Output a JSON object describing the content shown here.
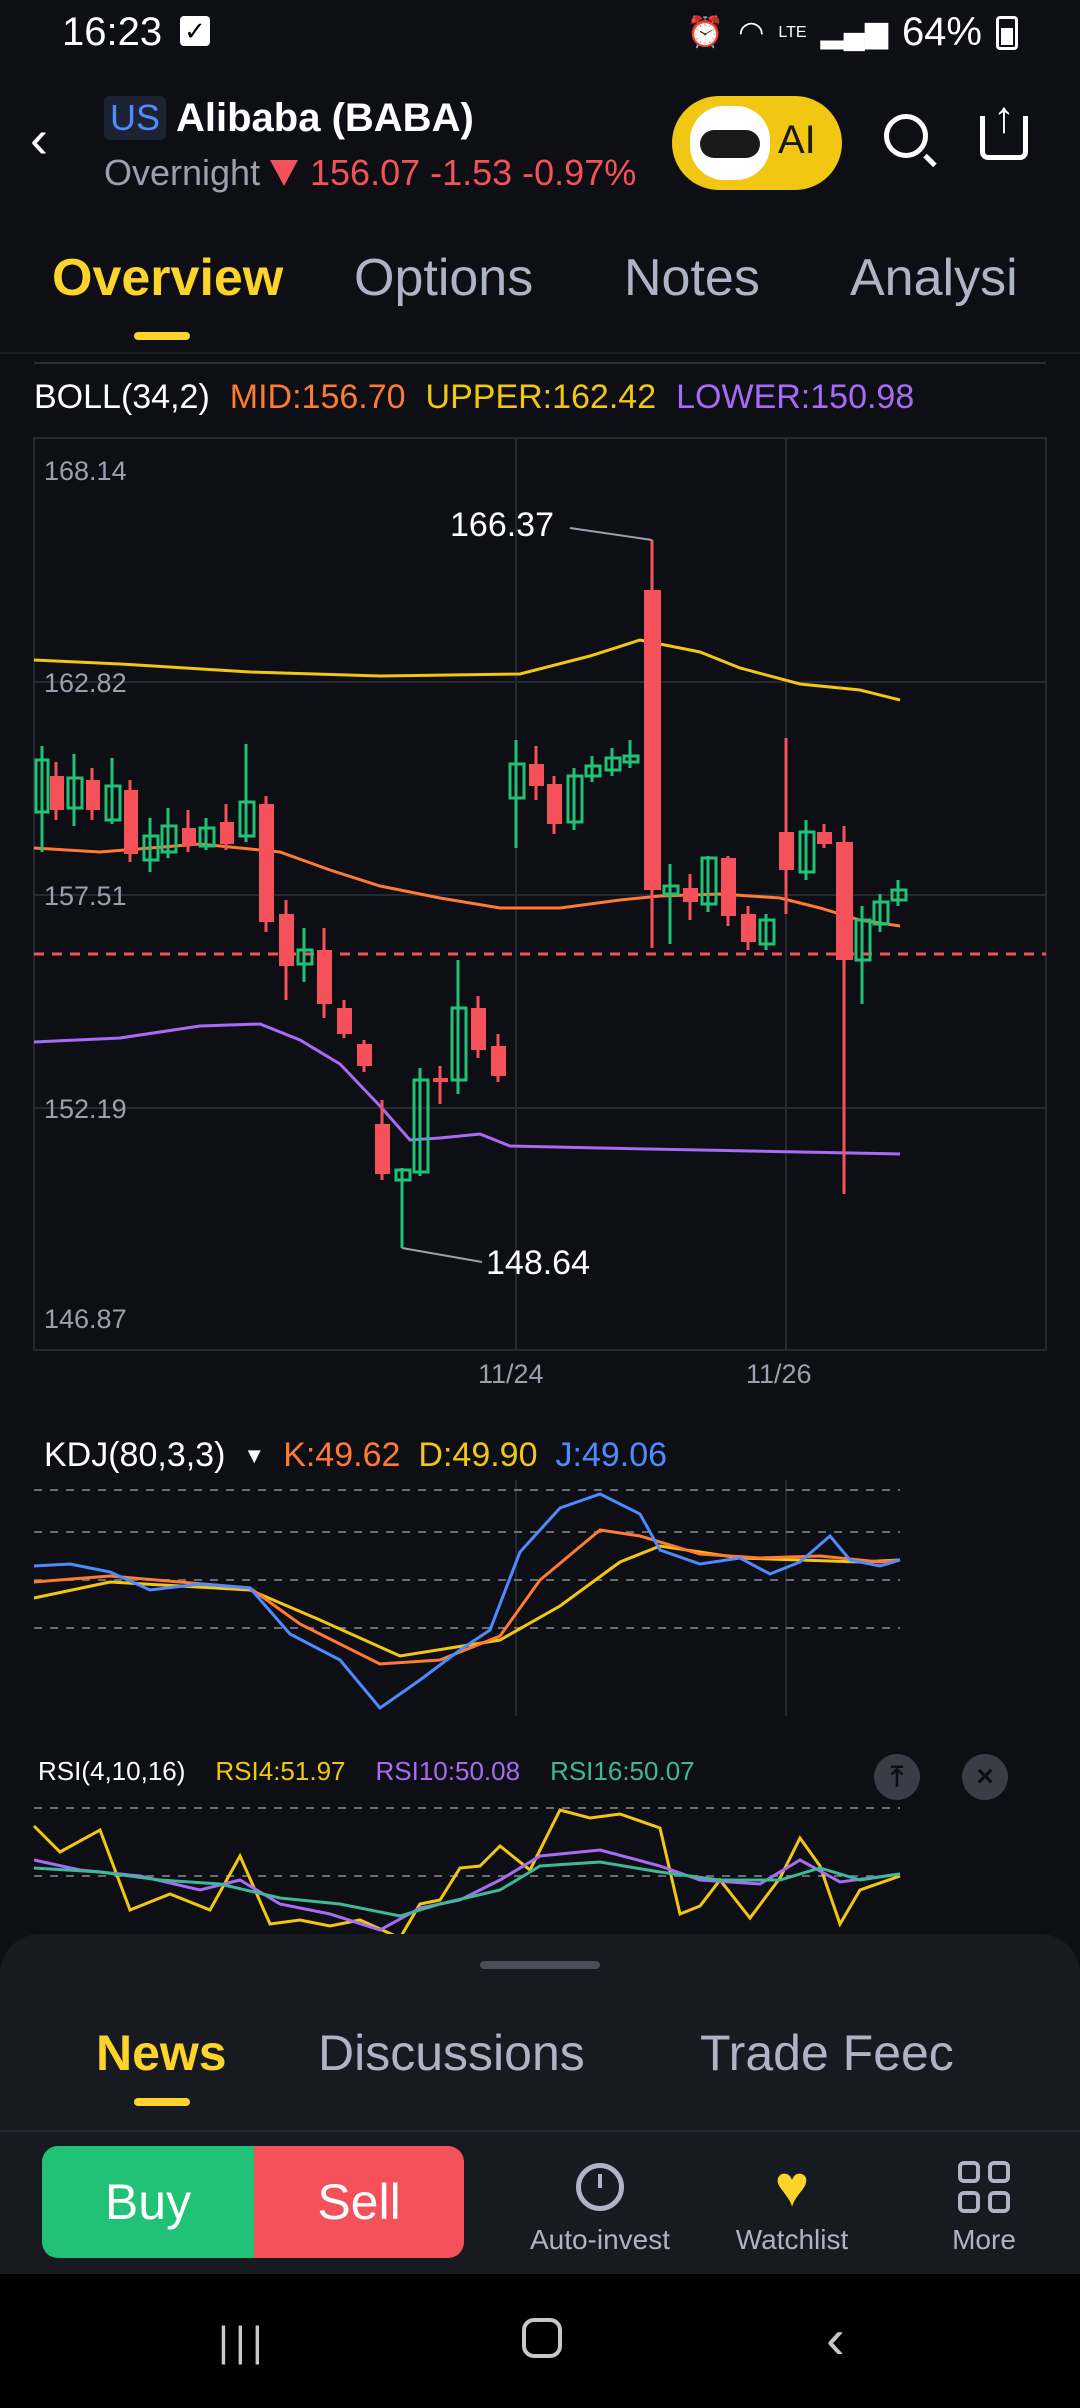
{
  "status_bar": {
    "time": "16:23",
    "battery": "64%",
    "network": "LTE"
  },
  "header": {
    "back_icon": "chevron-left-icon",
    "market": "US",
    "stock_name": "Alibaba (BABA)",
    "session": "Overnight",
    "quote": "156.07 -1.53 -0.97%",
    "ai_label": "AI"
  },
  "tabs": [
    "Overview",
    "Options",
    "Notes",
    "Analysi"
  ],
  "boll": {
    "label": "BOLL(34,2)",
    "mid": "MID:156.70",
    "upper": "UPPER:162.42",
    "lower": "LOWER:150.98"
  },
  "price_chart": {
    "y_labels": [
      "168.14",
      "162.82",
      "157.51",
      "152.19",
      "146.87"
    ],
    "x_labels": [
      "11/24",
      "11/26"
    ],
    "high_marker": "166.37",
    "low_marker": "148.64"
  },
  "kdj": {
    "label": "KDJ(80,3,3)",
    "k": "K:49.62",
    "d": "D:49.90",
    "j": "J:49.06"
  },
  "rsi": {
    "label": "RSI(4,10,16)",
    "rsi4": "RSI4:51.97",
    "rsi10": "RSI10:50.08",
    "rsi16": "RSI16:50.07"
  },
  "bottom_tabs": [
    "News",
    "Discussions",
    "Trade Feec"
  ],
  "actions": {
    "buy": "Buy",
    "sell": "Sell",
    "auto_invest": "Auto-invest",
    "watchlist": "Watchlist",
    "more": "More"
  },
  "colors": {
    "up": "#21c277",
    "down": "#f4515a",
    "accent": "#ffd42a",
    "mid": "#ff7a33",
    "upper": "#f2c713",
    "lower": "#a86bf5",
    "k": "#ff7a33",
    "d": "#f2c713",
    "j": "#4d8bff"
  }
}
